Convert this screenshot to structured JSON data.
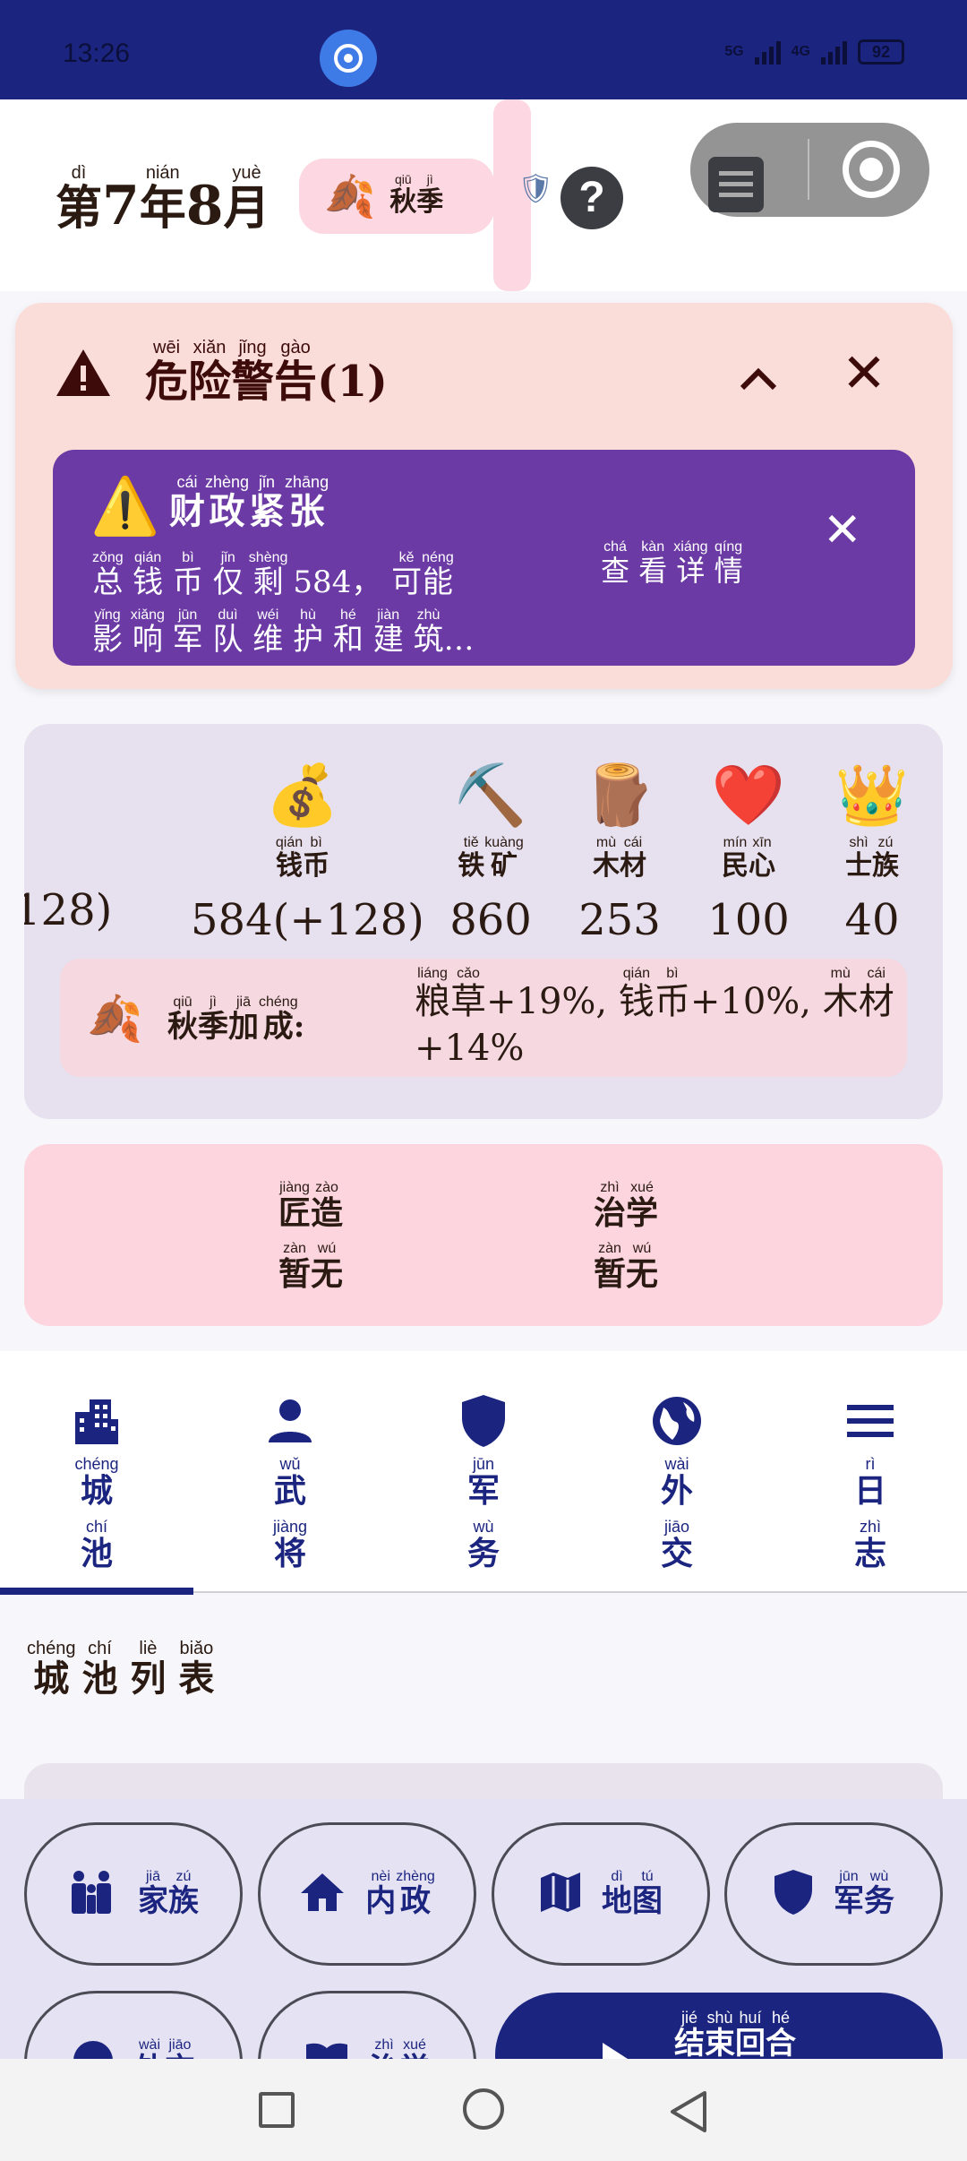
{
  "status_bar": {
    "time": "13:26",
    "network_1": "5G",
    "network_2": "4G",
    "battery": "92"
  },
  "header": {
    "date_prefix": {
      "char": "第",
      "pinyin": "dì"
    },
    "year_num": "7",
    "year_char": {
      "char": "年",
      "pinyin": "nián"
    },
    "month_num": "8",
    "month_char": {
      "char": "月",
      "pinyin": "yuè"
    },
    "season": [
      {
        "char": "秋",
        "pinyin": "qiū"
      },
      {
        "char": "季",
        "pinyin": "jì"
      }
    ],
    "help_label": "?"
  },
  "warning": {
    "title": [
      {
        "char": "危",
        "pinyin": "wēi"
      },
      {
        "char": "险",
        "pinyin": "xiǎn"
      },
      {
        "char": "警",
        "pinyin": "jǐng"
      },
      {
        "char": "告",
        "pinyin": "gào"
      }
    ],
    "count": "(1)",
    "collapse_label": "^",
    "close_label": "✕",
    "alert": {
      "icon": "⚠️",
      "title": [
        {
          "char": "财",
          "pinyin": "cái"
        },
        {
          "char": "政",
          "pinyin": "zhèng"
        },
        {
          "char": "紧",
          "pinyin": "jǐn"
        },
        {
          "char": "张",
          "pinyin": "zhāng"
        }
      ],
      "line1": [
        {
          "char": "总",
          "pinyin": "zǒng"
        },
        {
          "char": "钱",
          "pinyin": "qián"
        },
        {
          "char": "币",
          "pinyin": "bì"
        },
        {
          "char": "仅",
          "pinyin": "jǐn"
        },
        {
          "char": "剩",
          "pinyin": "shèng"
        }
      ],
      "amount": "584，",
      "line1_end": [
        {
          "char": "可",
          "pinyin": "kě"
        },
        {
          "char": "能",
          "pinyin": "néng"
        }
      ],
      "line2": [
        {
          "char": "影",
          "pinyin": "yǐng"
        },
        {
          "char": "响",
          "pinyin": "xiǎng"
        },
        {
          "char": "军",
          "pinyin": "jūn"
        },
        {
          "char": "队",
          "pinyin": "duì"
        },
        {
          "char": "维",
          "pinyin": "wéi"
        },
        {
          "char": "护",
          "pinyin": "hù"
        },
        {
          "char": "和",
          "pinyin": "hé"
        },
        {
          "char": "建",
          "pinyin": "jiàn"
        },
        {
          "char": "筑",
          "pinyin": "zhù"
        }
      ],
      "ellipsis": "…",
      "link": [
        {
          "char": "查",
          "pinyin": "chá"
        },
        {
          "char": "看",
          "pinyin": "kàn"
        },
        {
          "char": "详",
          "pinyin": "xiáng"
        },
        {
          "char": "情",
          "pinyin": "qíng"
        }
      ],
      "close_label": "✕"
    }
  },
  "resources": {
    "cut_value": "128)",
    "items": [
      {
        "icon": "money-bag-icon",
        "glyph": "💰",
        "label": [
          {
            "char": "钱",
            "pinyin": "qián"
          },
          {
            "char": "币",
            "pinyin": "bì"
          }
        ],
        "value": "584(+128)"
      },
      {
        "icon": "pickaxe-icon",
        "glyph": "⛏️",
        "label": [
          {
            "char": "铁",
            "pinyin": "tiě"
          },
          {
            "char": "矿",
            "pinyin": "kuàng"
          }
        ],
        "value": "860"
      },
      {
        "icon": "wood-icon",
        "glyph": "🪵",
        "label": [
          {
            "char": "木",
            "pinyin": "mù"
          },
          {
            "char": "材",
            "pinyin": "cái"
          }
        ],
        "value": "253"
      },
      {
        "icon": "heart-icon",
        "glyph": "❤️",
        "label": [
          {
            "char": "民",
            "pinyin": "mín"
          },
          {
            "char": "心",
            "pinyin": "xīn"
          }
        ],
        "value": "100"
      },
      {
        "icon": "crown-icon",
        "glyph": "👑",
        "label": [
          {
            "char": "士",
            "pinyin": "shì"
          },
          {
            "char": "族",
            "pinyin": "zú"
          }
        ],
        "value": "40"
      }
    ],
    "bonus": {
      "title": [
        {
          "char": "秋",
          "pinyin": "qiū"
        },
        {
          "char": "季",
          "pinyin": "jì"
        },
        {
          "char": "加",
          "pinyin": "jiā"
        },
        {
          "char": "成",
          "pinyin": "chéng"
        }
      ],
      "colon": ":",
      "grain": [
        {
          "char": "粮",
          "pinyin": "liáng"
        },
        {
          "char": "草",
          "pinyin": "cǎo"
        }
      ],
      "grain_value": "+19%,",
      "money": [
        {
          "char": "钱",
          "pinyin": "qián"
        },
        {
          "char": "币",
          "pinyin": "bì"
        }
      ],
      "money_value": "+10%,",
      "wood": [
        {
          "char": "木",
          "pinyin": "mù"
        },
        {
          "char": "材",
          "pinyin": "cái"
        }
      ],
      "wood_value": "+14%"
    }
  },
  "slots": [
    {
      "title": [
        {
          "char": "匠",
          "pinyin": "jiàng"
        },
        {
          "char": "造",
          "pinyin": "zào"
        }
      ],
      "value": [
        {
          "char": "暂",
          "pinyin": "zàn"
        },
        {
          "char": "无",
          "pinyin": "wú"
        }
      ]
    },
    {
      "title": [
        {
          "char": "治",
          "pinyin": "zhì"
        },
        {
          "char": "学",
          "pinyin": "xué"
        }
      ],
      "value": [
        {
          "char": "暂",
          "pinyin": "zàn"
        },
        {
          "char": "无",
          "pinyin": "wú"
        }
      ]
    }
  ],
  "tabs": [
    {
      "name": "city",
      "icon": "building-icon",
      "l1": {
        "char": "城",
        "pinyin": "chéng"
      },
      "l2": {
        "char": "池",
        "pinyin": "chí"
      },
      "active": true
    },
    {
      "name": "generals",
      "icon": "person-icon",
      "l1": {
        "char": "武",
        "pinyin": "wǔ"
      },
      "l2": {
        "char": "将",
        "pinyin": "jiàng"
      },
      "active": false
    },
    {
      "name": "military",
      "icon": "shield-icon",
      "l1": {
        "char": "军",
        "pinyin": "jūn"
      },
      "l2": {
        "char": "务",
        "pinyin": "wù"
      },
      "active": false
    },
    {
      "name": "diplomacy",
      "icon": "globe-icon",
      "l1": {
        "char": "外",
        "pinyin": "wài"
      },
      "l2": {
        "char": "交",
        "pinyin": "jiāo"
      },
      "active": false
    },
    {
      "name": "log",
      "icon": "menu-icon",
      "l1": {
        "char": "日",
        "pinyin": "rì"
      },
      "l2": {
        "char": "志",
        "pinyin": "zhì"
      },
      "active": false
    }
  ],
  "list_title": [
    {
      "char": "城",
      "pinyin": "chéng"
    },
    {
      "char": "池",
      "pinyin": "chí"
    },
    {
      "char": "列",
      "pinyin": "liè"
    },
    {
      "char": "表",
      "pinyin": "biǎo"
    }
  ],
  "bottom_buttons": [
    {
      "name": "family",
      "icon": "family-icon",
      "label": [
        {
          "char": "家",
          "pinyin": "jiā"
        },
        {
          "char": "族",
          "pinyin": "zú"
        }
      ]
    },
    {
      "name": "domestic",
      "icon": "home-icon",
      "label": [
        {
          "char": "内",
          "pinyin": "nèi"
        },
        {
          "char": "政",
          "pinyin": "zhèng"
        }
      ]
    },
    {
      "name": "map",
      "icon": "map-icon",
      "label": [
        {
          "char": "地",
          "pinyin": "dì"
        },
        {
          "char": "图",
          "pinyin": "tú"
        }
      ]
    },
    {
      "name": "military",
      "icon": "shield-icon",
      "label": [
        {
          "char": "军",
          "pinyin": "jūn"
        },
        {
          "char": "务",
          "pinyin": "wù"
        }
      ]
    },
    {
      "name": "diplomacy",
      "icon": "globe-icon",
      "label": [
        {
          "char": "外",
          "pinyin": "wài"
        },
        {
          "char": "交",
          "pinyin": "jiāo"
        }
      ]
    },
    {
      "name": "study",
      "icon": "book-icon",
      "label": [
        {
          "char": "治",
          "pinyin": "zhì"
        },
        {
          "char": "学",
          "pinyin": "xué"
        }
      ]
    }
  ],
  "end_turn": [
    {
      "char": "结",
      "pinyin": "jié"
    },
    {
      "char": "束",
      "pinyin": "shù"
    },
    {
      "char": "回",
      "pinyin": "huí"
    },
    {
      "char": "合",
      "pinyin": "hé"
    }
  ]
}
